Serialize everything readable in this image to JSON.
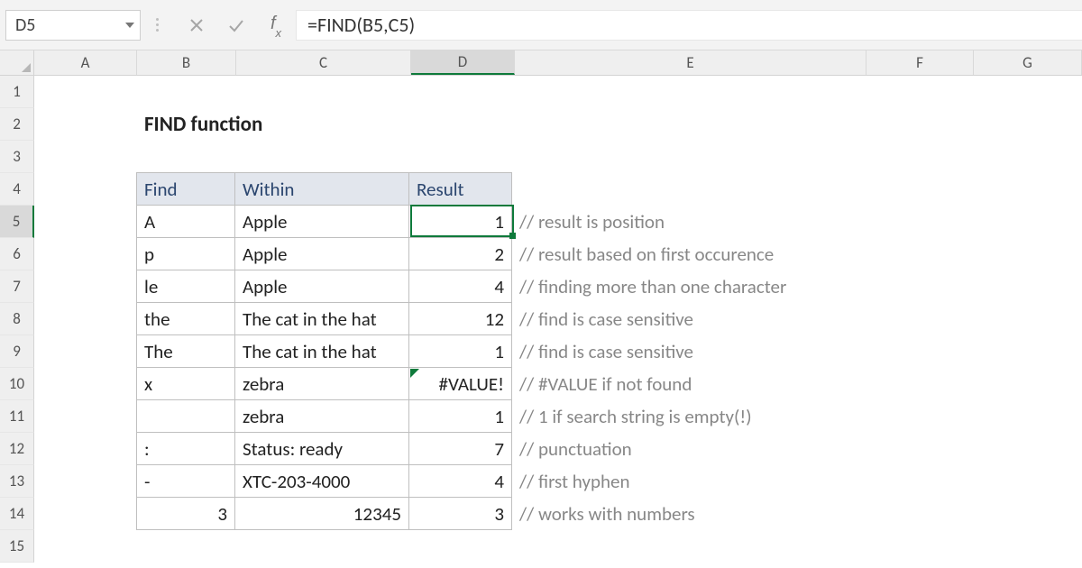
{
  "name_box": "D5",
  "formula_bar": "=FIND(B5,C5)",
  "columns": [
    "A",
    "B",
    "C",
    "D",
    "E",
    "F",
    "G"
  ],
  "selected_column": "D",
  "selected_row": 5,
  "title_cell": "FIND function",
  "headers": {
    "find": "Find",
    "within": "Within",
    "result": "Result"
  },
  "rows": [
    {
      "find": "A",
      "within": "Apple",
      "result": "1",
      "note": "// result is position"
    },
    {
      "find": "p",
      "within": "Apple",
      "result": "2",
      "note": "// result based on first occurence"
    },
    {
      "find": "le",
      "within": "Apple",
      "result": "4",
      "note": "// finding more than one character"
    },
    {
      "find": "the",
      "within": "The cat in the hat",
      "result": "12",
      "note": "// find is case sensitive"
    },
    {
      "find": "The",
      "within": "The cat in the hat",
      "result": "1",
      "note": "// find is case sensitive"
    },
    {
      "find": "x",
      "within": "zebra",
      "result": "#VALUE!",
      "note": "// #VALUE if not found",
      "error": true
    },
    {
      "find": "",
      "within": "zebra",
      "result": "1",
      "note": "// 1 if search string is empty(!)"
    },
    {
      "find": ":",
      "within": "Status: ready",
      "result": "7",
      "note": "// punctuation"
    },
    {
      "find": "-",
      "within": "XTC-203-4000",
      "result": "4",
      "note": "// first hyphen"
    },
    {
      "find": "3",
      "find_right": true,
      "within": "12345",
      "within_right": true,
      "result": "3",
      "note": "// works with numbers"
    }
  ],
  "row_numbers": [
    1,
    2,
    3,
    4,
    5,
    6,
    7,
    8,
    9,
    10,
    11,
    12,
    13,
    14,
    15
  ],
  "chart_data": {
    "type": "table",
    "title": "FIND function",
    "columns": [
      "Find",
      "Within",
      "Result",
      "Comment"
    ],
    "rows": [
      [
        "A",
        "Apple",
        1,
        "result is position"
      ],
      [
        "p",
        "Apple",
        2,
        "result based on first occurence"
      ],
      [
        "le",
        "Apple",
        4,
        "finding more than one character"
      ],
      [
        "the",
        "The cat in the hat",
        12,
        "find is case sensitive"
      ],
      [
        "The",
        "The cat in the hat",
        1,
        "find is case sensitive"
      ],
      [
        "x",
        "zebra",
        "#VALUE!",
        "#VALUE if not found"
      ],
      [
        "",
        "zebra",
        1,
        "1 if search string is empty(!)"
      ],
      [
        ":",
        "Status: ready",
        7,
        "punctuation"
      ],
      [
        "-",
        "XTC-203-4000",
        4,
        "first hyphen"
      ],
      [
        3,
        12345,
        3,
        "works with numbers"
      ]
    ]
  }
}
